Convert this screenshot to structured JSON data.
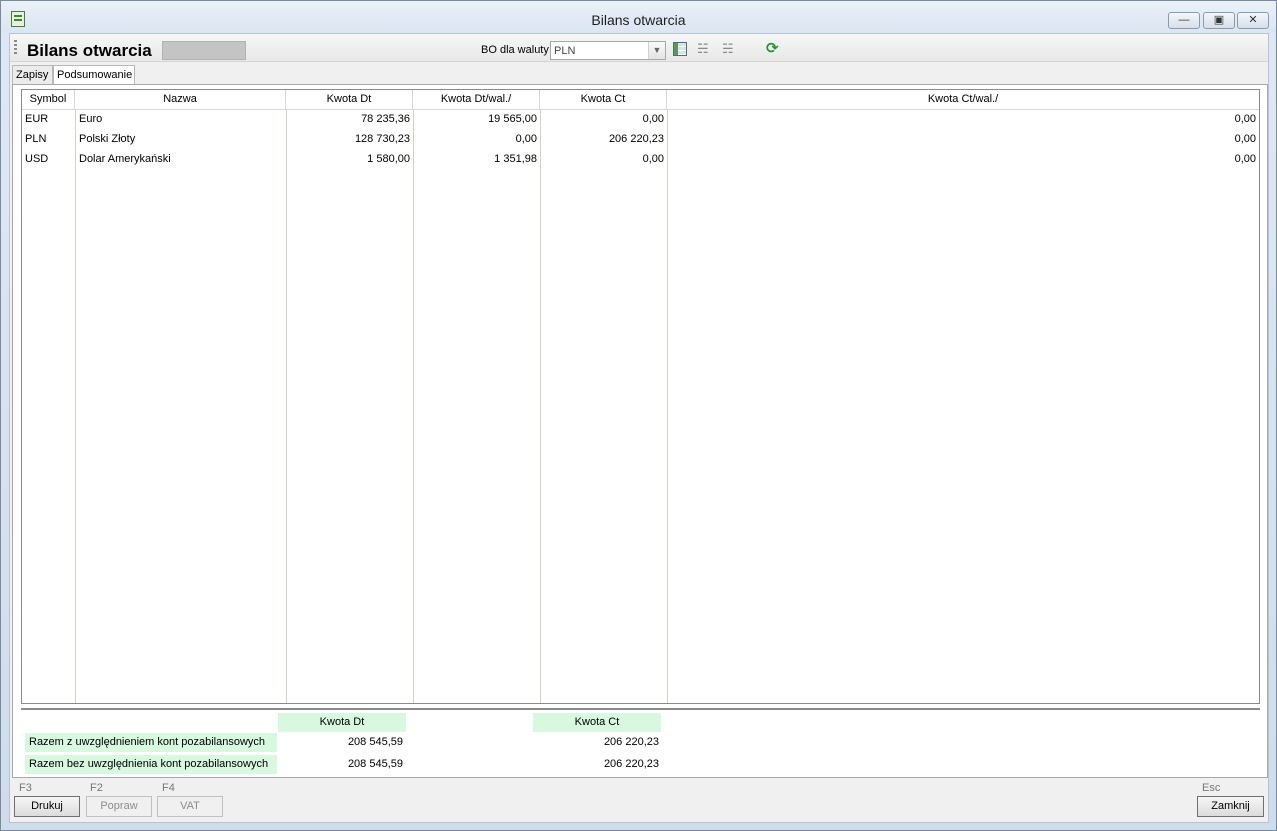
{
  "window": {
    "title": "Bilans otwarcia"
  },
  "header": {
    "title": "Bilans otwarcia",
    "currency_label": "BO dla waluty",
    "currency_value": "PLN"
  },
  "tabs": [
    {
      "label": "Zapisy",
      "active": false
    },
    {
      "label": "Podsumowanie",
      "active": true
    }
  ],
  "grid": {
    "columns": [
      "Symbol",
      "Nazwa",
      "Kwota Dt",
      "Kwota Dt/wal./",
      "Kwota Ct",
      "Kwota Ct/wal./"
    ],
    "rows": [
      {
        "symbol": "EUR",
        "nazwa": "Euro",
        "kwota_dt": "78 235,36",
        "kwota_dt_wal": "19 565,00",
        "kwota_ct": "0,00",
        "kwota_ct_wal": "0,00"
      },
      {
        "symbol": "PLN",
        "nazwa": "Polski Złoty",
        "kwota_dt": "128 730,23",
        "kwota_dt_wal": "0,00",
        "kwota_ct": "206 220,23",
        "kwota_ct_wal": "0,00"
      },
      {
        "symbol": "USD",
        "nazwa": "Dolar Amerykański",
        "kwota_dt": "1 580,00",
        "kwota_dt_wal": "1 351,98",
        "kwota_ct": "0,00",
        "kwota_ct_wal": "0,00"
      }
    ]
  },
  "summary": {
    "header_dt": "Kwota Dt",
    "header_ct": "Kwota Ct",
    "rows": [
      {
        "label": "Razem z uwzględnieniem kont pozabilansowych",
        "dt": "208 545,59",
        "ct": "206 220,23"
      },
      {
        "label": "Razem bez uwzględnienia kont pozabilansowych",
        "dt": "208 545,59",
        "ct": "206 220,23"
      }
    ]
  },
  "footer": {
    "buttons": [
      {
        "key": "F3",
        "label": "Drukuj",
        "enabled": true
      },
      {
        "key": "F2",
        "label": "Popraw",
        "enabled": false
      },
      {
        "key": "F4",
        "label": "VAT",
        "enabled": false
      },
      {
        "key": "Esc",
        "label": "Zamknij",
        "enabled": true
      }
    ]
  },
  "icons": {
    "app": "spreadsheet-app-icon",
    "toolbar": [
      "grid-view-icon",
      "tree-expand-icon",
      "tree-collapse-icon",
      "refresh-icon"
    ]
  },
  "colors": {
    "summary_header_bg": "#d8f8e0",
    "refresh_icon": "#1e9a2a"
  }
}
